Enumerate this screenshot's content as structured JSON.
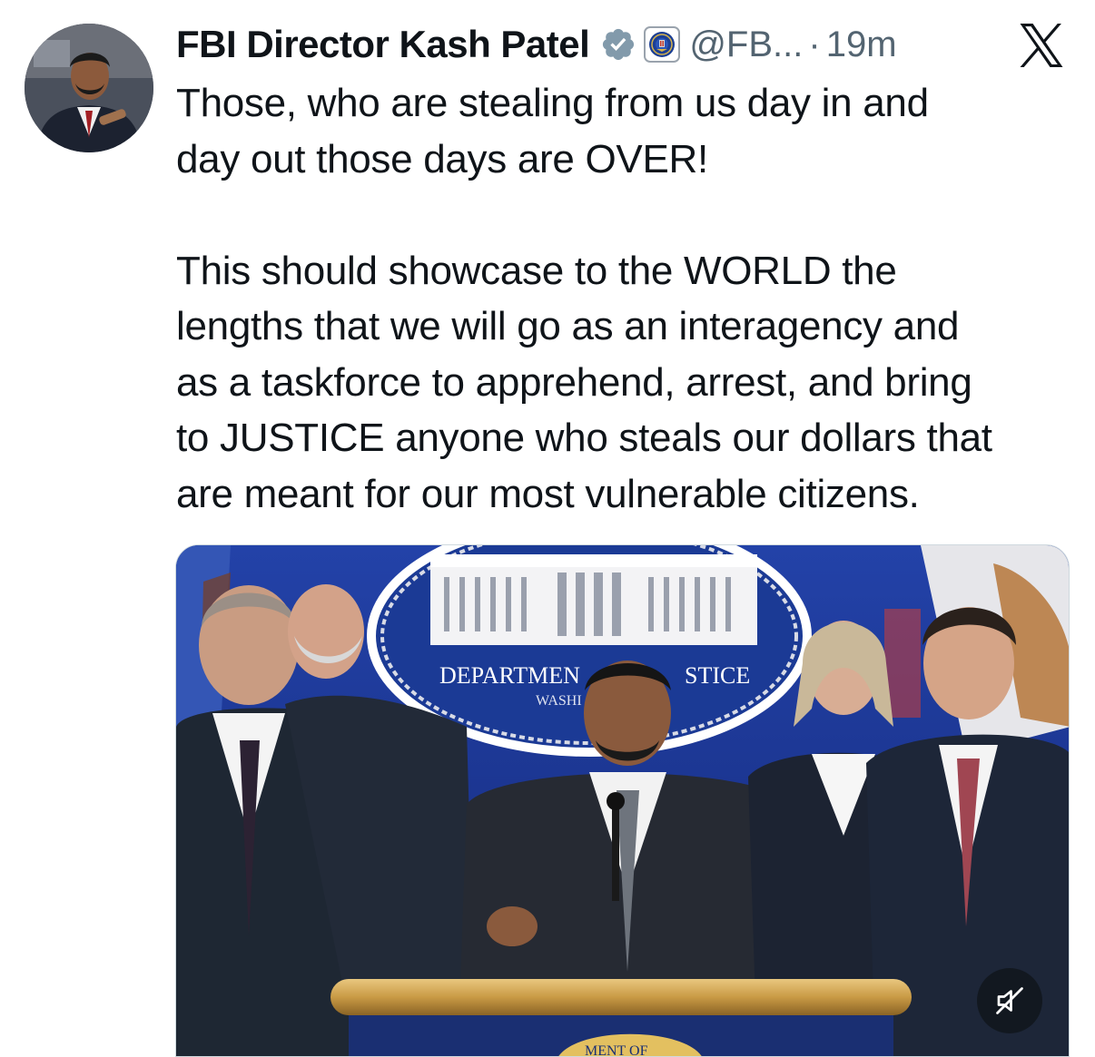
{
  "author": {
    "name": "FBI Director Kash Patel",
    "handle": "@FB...",
    "separator": "·",
    "timestamp": "19m",
    "verified_icon": "verified-badge-icon",
    "affiliation_icon": "fbi-seal-icon"
  },
  "platform": {
    "logo_icon": "x-logo-icon"
  },
  "tweet": {
    "paragraph_1": "Those, who are stealing from us day in and\nday out those days are OVER!",
    "paragraph_2": "This should showcase to the WORLD the\nlengths that we will go as an interagency and\nas a taskforce to apprehend, arrest, and bring\nto JUSTICE anyone who steals our dollars that\nare meant for our most vulnerable citizens."
  },
  "media": {
    "banner_line_1_left": "DEPARTMEN",
    "banner_line_1_right": "STICE",
    "banner_line_2": "WASHI",
    "podium_seal_text": "MENT OF",
    "mute_icon": "speaker-muted-icon"
  },
  "colors": {
    "text": "#0f1419",
    "secondary_text": "#536471",
    "verified": "#829aab",
    "backdrop_blue": "#1d3a9a"
  }
}
